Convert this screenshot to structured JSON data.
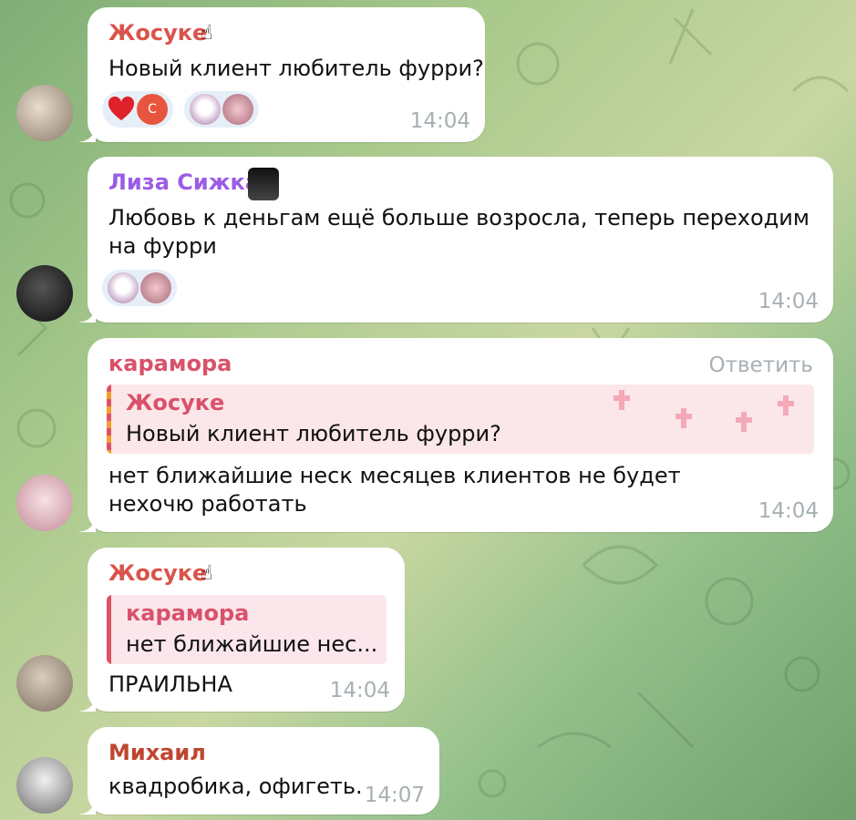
{
  "colors": {
    "zhosuke": "#d9544b",
    "liza": "#9b5ce6",
    "karamora": "#d9516a",
    "mikhail": "#c0452f",
    "time": "#a7b0b3",
    "heart": "#e0202a",
    "c_badge": "#e8553f"
  },
  "messages": [
    {
      "sender": "Жосуке",
      "text": "Новый клиент любитель фурри?",
      "time": "14:04",
      "reactions": [
        {
          "emoji": "heart",
          "user_initial": "С"
        },
        {
          "sticker": "my-melody-sticker"
        }
      ]
    },
    {
      "sender": "Лиза Сижка",
      "text": "Любовь к деньгам ещё больше возросла, теперь переходим на фурри",
      "time": "14:04",
      "reactions": [
        {
          "sticker": "my-melody-sticker"
        }
      ]
    },
    {
      "sender": "карамора",
      "reply_action": "Ответить",
      "quote": {
        "name": "Жосуке",
        "text": "Новый клиент любитель фурри?"
      },
      "text": "нет ближайшие неск месяцев клиентов не будет нехочю работать",
      "time": "14:04"
    },
    {
      "sender": "Жосуке",
      "quote": {
        "name": "карамора",
        "text": "нет ближайшие нес..."
      },
      "text": "ПРАИЛЬНА",
      "time": "14:04"
    },
    {
      "sender": "Михаил",
      "text": "квадробика, офигеть.",
      "time": "14:07"
    }
  ]
}
